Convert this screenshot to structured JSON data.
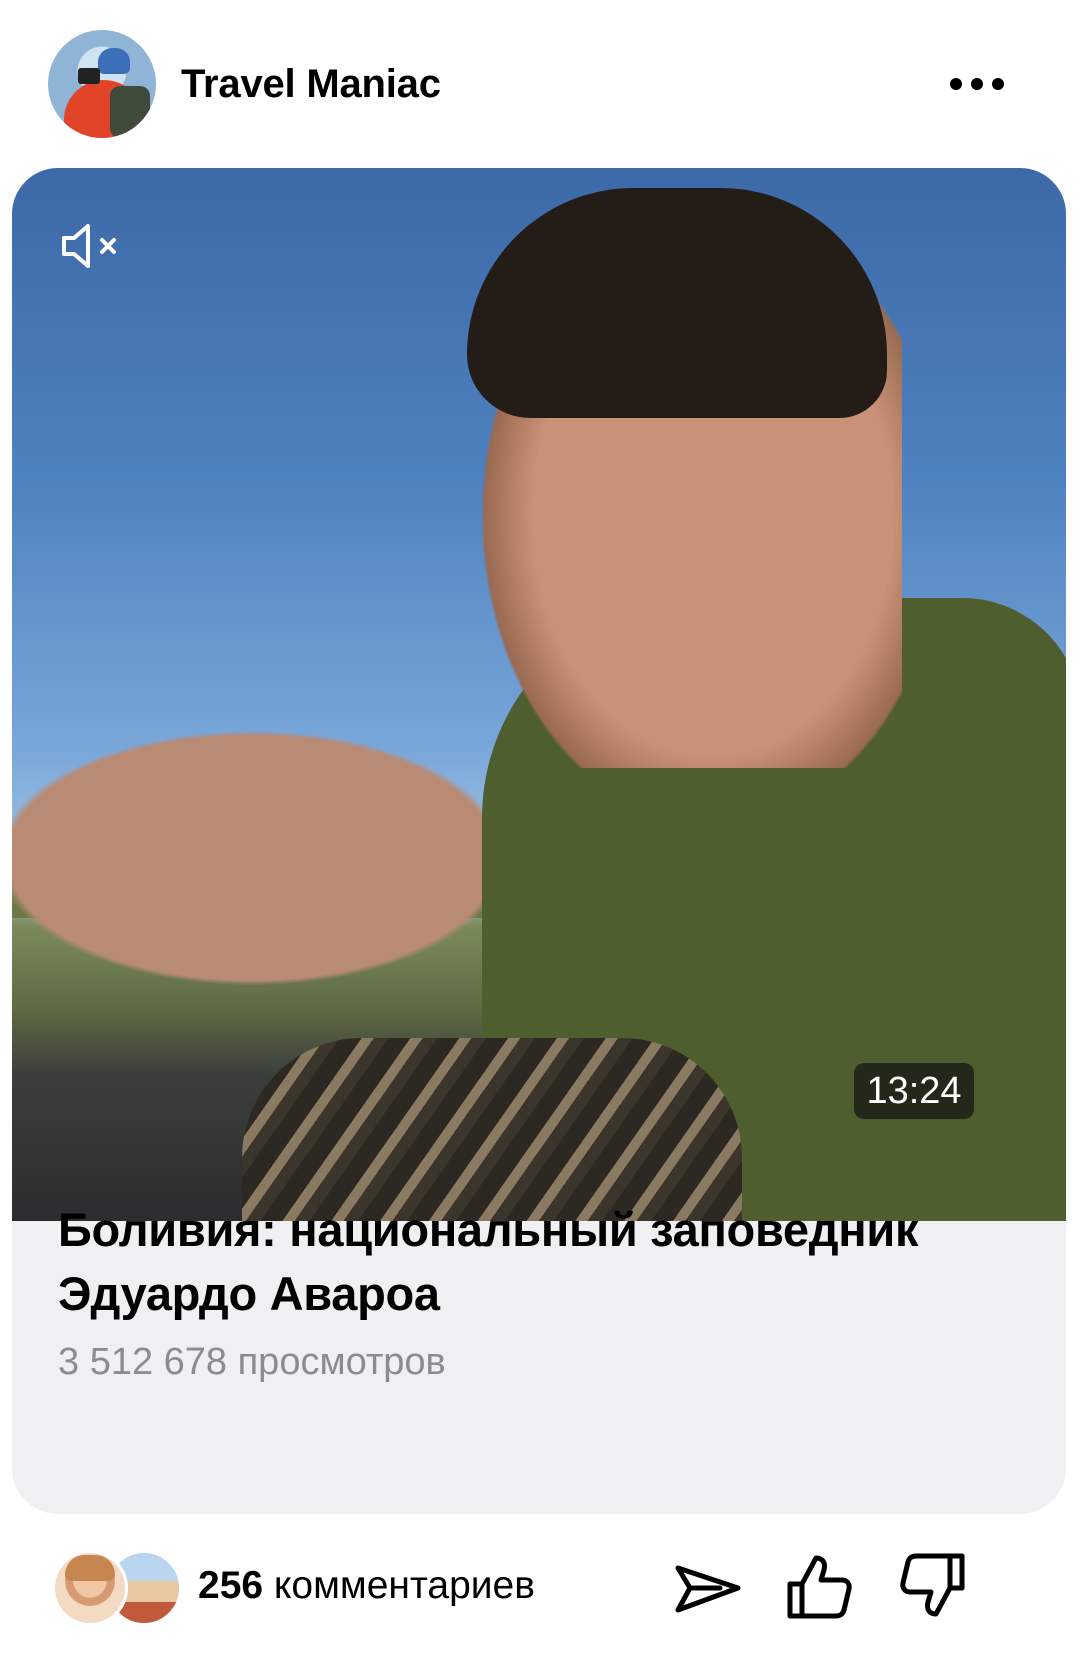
{
  "header": {
    "channel_name": "Travel Maniac",
    "more_icon": "more-dots-icon"
  },
  "video": {
    "muted_icon": "volume-muted-icon",
    "duration": "13:24"
  },
  "card": {
    "title": "Боливия: национальный заповедник Эдуардо Авароа",
    "views": "3 512 678 просмотров"
  },
  "footer": {
    "comments_count": "256",
    "comments_label": "комментариев",
    "actions": [
      "share-icon",
      "like-icon",
      "dislike-icon"
    ]
  }
}
